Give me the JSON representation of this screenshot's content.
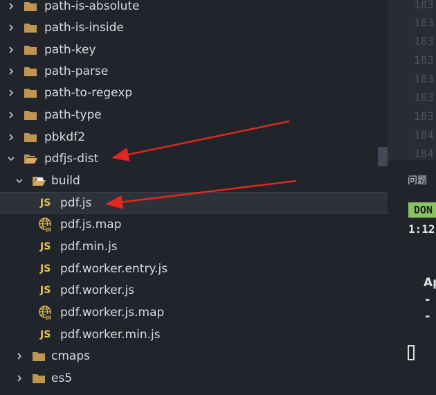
{
  "explorer": {
    "items": [
      {
        "label": "path-is-absolute",
        "kind": "folder",
        "state": "collapsed"
      },
      {
        "label": "path-is-inside",
        "kind": "folder",
        "state": "collapsed"
      },
      {
        "label": "path-key",
        "kind": "folder",
        "state": "collapsed"
      },
      {
        "label": "path-parse",
        "kind": "folder",
        "state": "collapsed"
      },
      {
        "label": "path-to-regexp",
        "kind": "folder",
        "state": "collapsed"
      },
      {
        "label": "path-type",
        "kind": "folder",
        "state": "collapsed"
      },
      {
        "label": "pbkdf2",
        "kind": "folder",
        "state": "collapsed"
      },
      {
        "label": "pdfjs-dist",
        "kind": "folder",
        "state": "expanded"
      },
      {
        "label": "build",
        "kind": "folder",
        "state": "expanded"
      },
      {
        "label": "pdf.js",
        "kind": "js",
        "selected": true
      },
      {
        "label": "pdf.js.map",
        "kind": "map"
      },
      {
        "label": "pdf.min.js",
        "kind": "js"
      },
      {
        "label": "pdf.worker.entry.js",
        "kind": "js"
      },
      {
        "label": "pdf.worker.js",
        "kind": "js"
      },
      {
        "label": "pdf.worker.js.map",
        "kind": "map"
      },
      {
        "label": "pdf.worker.min.js",
        "kind": "js"
      },
      {
        "label": "cmaps",
        "kind": "folder",
        "state": "collapsed"
      },
      {
        "label": "es5",
        "kind": "folder",
        "state": "collapsed"
      }
    ],
    "js_badge": "JS"
  },
  "editor": {
    "line_numbers": [
      "183",
      "183",
      "183",
      "183",
      "183",
      "183",
      "183",
      "184",
      "184"
    ]
  },
  "panel": {
    "tab_label": "问题",
    "status_badge": "DON",
    "position_text": "1:12",
    "ap_text": "Ap",
    "dash_1": "-",
    "dash_2": "-"
  },
  "colors": {
    "sidebar_bg": "#21252b",
    "editor_bg": "#282c34",
    "text": "#d7dae0",
    "folder": "#c09553",
    "js_yellow": "#e5c150",
    "arrow_red": "#e0281f",
    "done_green": "#8cc265"
  }
}
